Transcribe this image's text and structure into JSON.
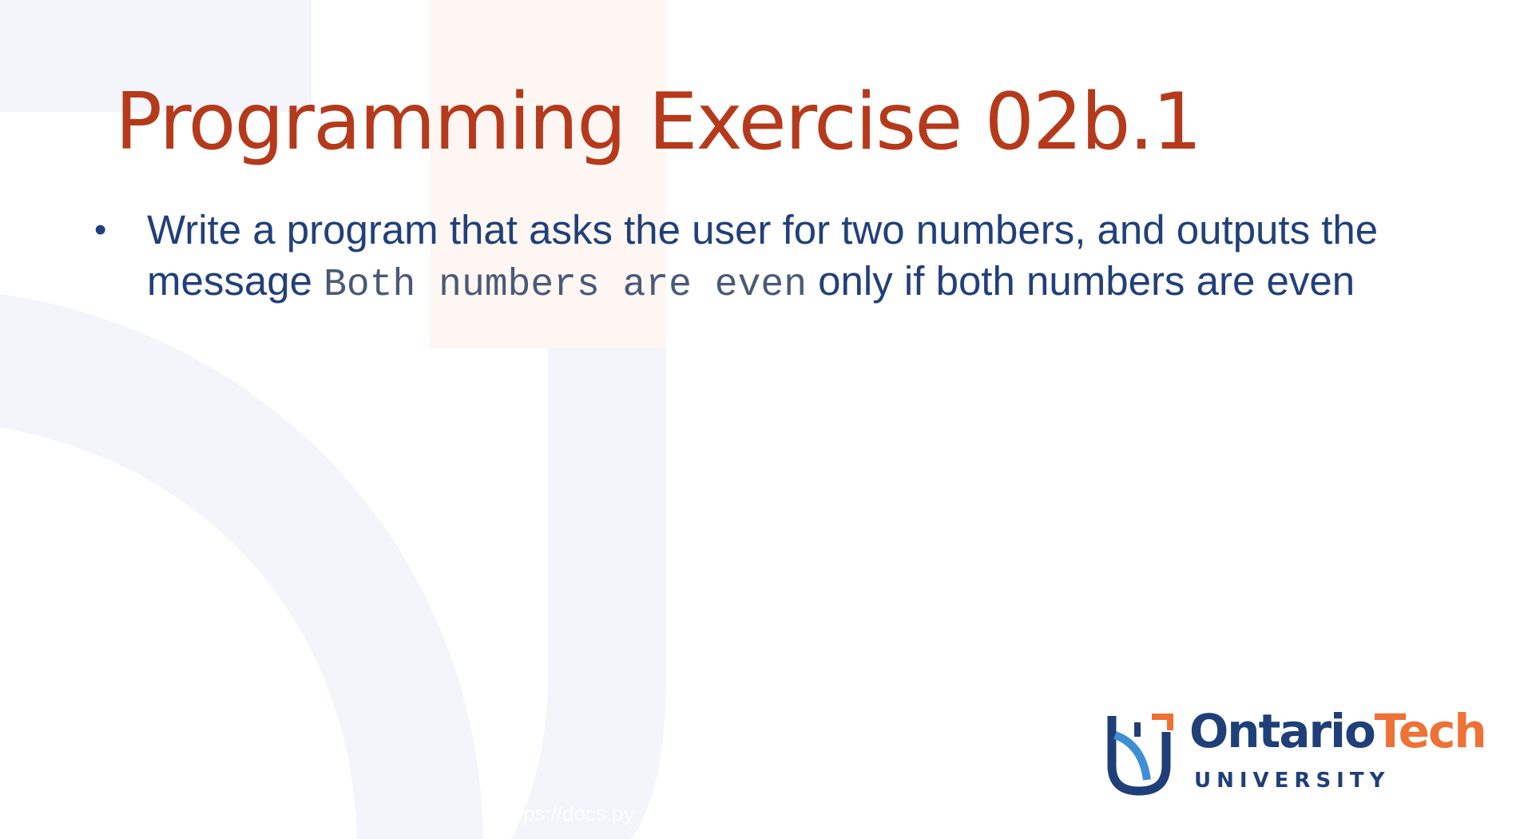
{
  "slide": {
    "title": "Programming Exercise 02b.1",
    "bullets": [
      {
        "text_before": "Write a program that asks the user for two numbers, and outputs the message ",
        "code": "Both numbers are even",
        "text_after": " only if both numbers are even"
      }
    ],
    "footer_url": "https://docs.py"
  },
  "logo": {
    "word_ontario": "Ontario",
    "word_tech": "Tech",
    "word_university": "UNIVERSITY"
  },
  "colors": {
    "title": "#b53a1b",
    "body_text": "#21407a",
    "code_text": "#4a5a75",
    "brand_blue": "#1f3f79",
    "brand_orange": "#ee7135",
    "bg_shape_blue": "#f3f5fa",
    "bg_shape_orange": "#fdf6f3"
  }
}
